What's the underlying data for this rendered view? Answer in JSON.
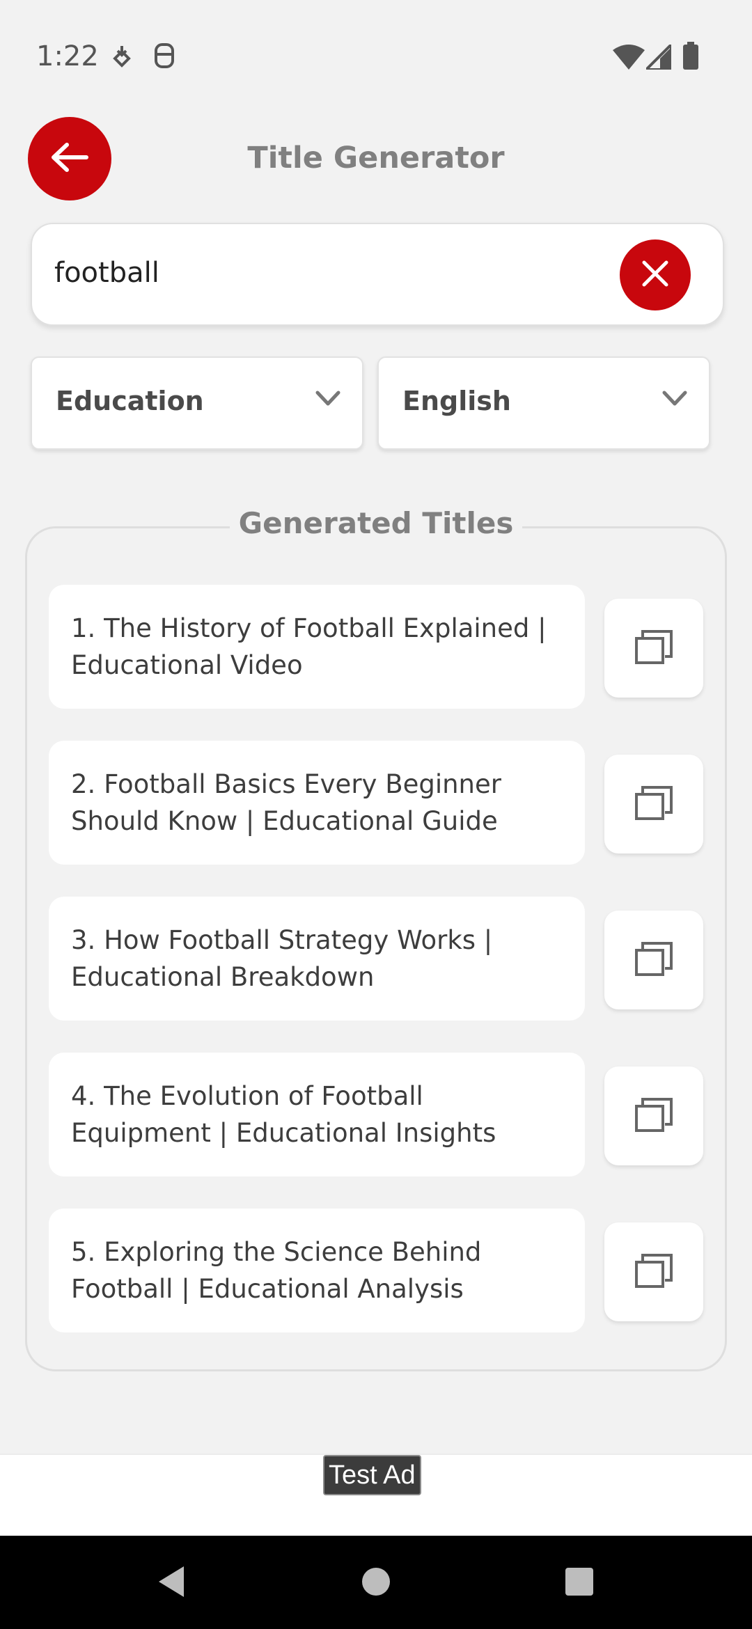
{
  "status_bar": {
    "time": "1:22",
    "icons": [
      "download-icon",
      "sim-icon",
      "wifi-icon",
      "signal-icon",
      "battery-icon"
    ]
  },
  "header": {
    "title": "Title Generator",
    "back_icon": "arrow-left-icon"
  },
  "search": {
    "value": "football",
    "clear_icon": "close-icon"
  },
  "filters": {
    "category": "Education",
    "language": "English"
  },
  "results": {
    "legend": "Generated Titles",
    "items": [
      {
        "text": "1. The History of Football Explained | Educational Video"
      },
      {
        "text": "2. Football Basics Every Beginner Should Know | Educational Guide"
      },
      {
        "text": "3. How Football Strategy Works | Educational Breakdown"
      },
      {
        "text": "4. The Evolution of Football Equipment | Educational Insights"
      },
      {
        "text": "5. Exploring the Science Behind Football | Educational Analysis"
      }
    ],
    "copy_icon": "copy-icon"
  },
  "ad": {
    "label": "Test Ad"
  },
  "nav": {
    "icons": [
      "back-triangle-icon",
      "home-circle-icon",
      "recents-square-icon"
    ]
  },
  "colors": {
    "accent": "#c8070d",
    "background": "#f2f2f2",
    "muted_text": "#808080"
  }
}
